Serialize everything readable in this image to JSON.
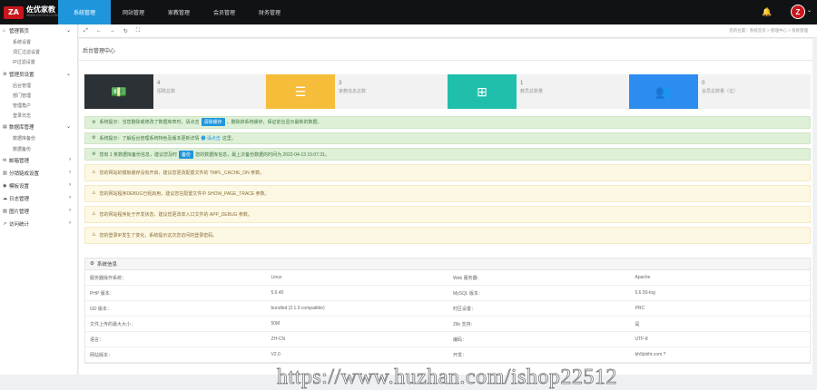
{
  "brand": {
    "logo_mark": "ZA",
    "name": "佐优家教",
    "subtitle": "WWW.ZUOYOU.COM"
  },
  "nav": [
    "系统管理",
    "网站管理",
    "家教管理",
    "会员管理",
    "财务管理"
  ],
  "nav_active": "系统管理",
  "sidebar": [
    {
      "label": "管理首页",
      "icon": "home-icon",
      "items": [
        "系统设置",
        "词汇过滤设置",
        "IP过滤设置"
      ]
    },
    {
      "label": "管理员设置",
      "icon": "gear-icon",
      "items": [
        "后台管理",
        "部门管理",
        "管理角户",
        "登录日志"
      ]
    },
    {
      "label": "数据库管理",
      "icon": "database-icon",
      "items": [
        "数据库备份",
        "数据备份"
      ]
    },
    {
      "label": "邮箱管理",
      "icon": "mail-icon",
      "items": []
    },
    {
      "label": "分销链成设置",
      "icon": "bar-chart-icon",
      "items": []
    },
    {
      "label": "模板设置",
      "icon": "palette-icon",
      "items": []
    },
    {
      "label": "日志管理",
      "icon": "cloud-icon",
      "items": []
    },
    {
      "label": "图片管理",
      "icon": "image-icon",
      "items": []
    },
    {
      "label": "访问统计",
      "icon": "line-chart-icon",
      "items": []
    }
  ],
  "toolbar": {
    "breadcrumb": "您的位置：系统首页 > 管理中心 > 系统管理"
  },
  "page_title": "后台管理中心",
  "stats": [
    {
      "num": "4",
      "label": "招聘总数",
      "color": "#2b3134",
      "icon": "cash-icon",
      "glyph": "💵"
    },
    {
      "num": "3",
      "label": "家教信息总数",
      "color": "#f6bd3a",
      "icon": "list-icon",
      "glyph": "☰"
    },
    {
      "num": "1",
      "label": "教员总数量",
      "color": "#1fbfac",
      "icon": "basket-icon",
      "glyph": "⊞"
    },
    {
      "num": "0",
      "label": "会员总数量（位）",
      "color": "#2d8cf0",
      "icon": "users-icon",
      "glyph": "👥"
    }
  ],
  "alerts": [
    {
      "type": "g",
      "pre": "系统提示：当您删除或修改了数据库表时，请点击",
      "tag": "清除缓存",
      "post": "，删除掉系统缓存，保证前台显示最新的数据。"
    },
    {
      "type": "g",
      "pre": "系统提示：了解后台管理系统特色及版本更新详情",
      "lnk": "➊ 请点击",
      "post": "这里。"
    },
    {
      "type": "g",
      "pre": "您有 1 条数据库备份信息，建议您及时",
      "tag": "备份",
      "post": "您的数据库信息，最上次备份数据的时间为 2022-04-13 15:07:31。"
    },
    {
      "type": "y",
      "pre": "您的网站的模板缓存没有开启，建议您更改配置文件的 TMPL_CACHE_ON 参数。"
    },
    {
      "type": "y",
      "pre": "您的网站程序DEBUG已经启用，建议您在配置文件中 SHOW_PAGE_TRACE 参数。"
    },
    {
      "type": "y",
      "pre": "您的网站程序处于开发状态，建议您更改单入口文件的 APP_DEBUG 参数。"
    },
    {
      "type": "y",
      "pre": "您的登录IP发生了变化，系统提示这次您访问的登录密码。"
    }
  ],
  "sysinfo": {
    "title": "系统信息",
    "rows": [
      [
        "服务器操作系统：",
        "Linux",
        "Web 服务器：",
        "Apache"
      ],
      [
        "PHP 版本：",
        "5.6.40",
        "MySQL 版本：",
        "5.6.50-log"
      ],
      [
        "GD 版本：",
        "bundled (2.1.0 compatible)",
        "时区设置：",
        "PRC"
      ],
      [
        "文件上传的最大大小：",
        "50M",
        "Zlib 支持：",
        "是"
      ],
      [
        "语言：",
        "ZH-CN",
        "编码：",
        "UTF-8"
      ],
      [
        "网站版本：",
        "V2.0",
        "开发：",
        "bh9jxbht.com ?"
      ]
    ]
  },
  "watermark": "https://www.huzhan.com/ishop22512"
}
